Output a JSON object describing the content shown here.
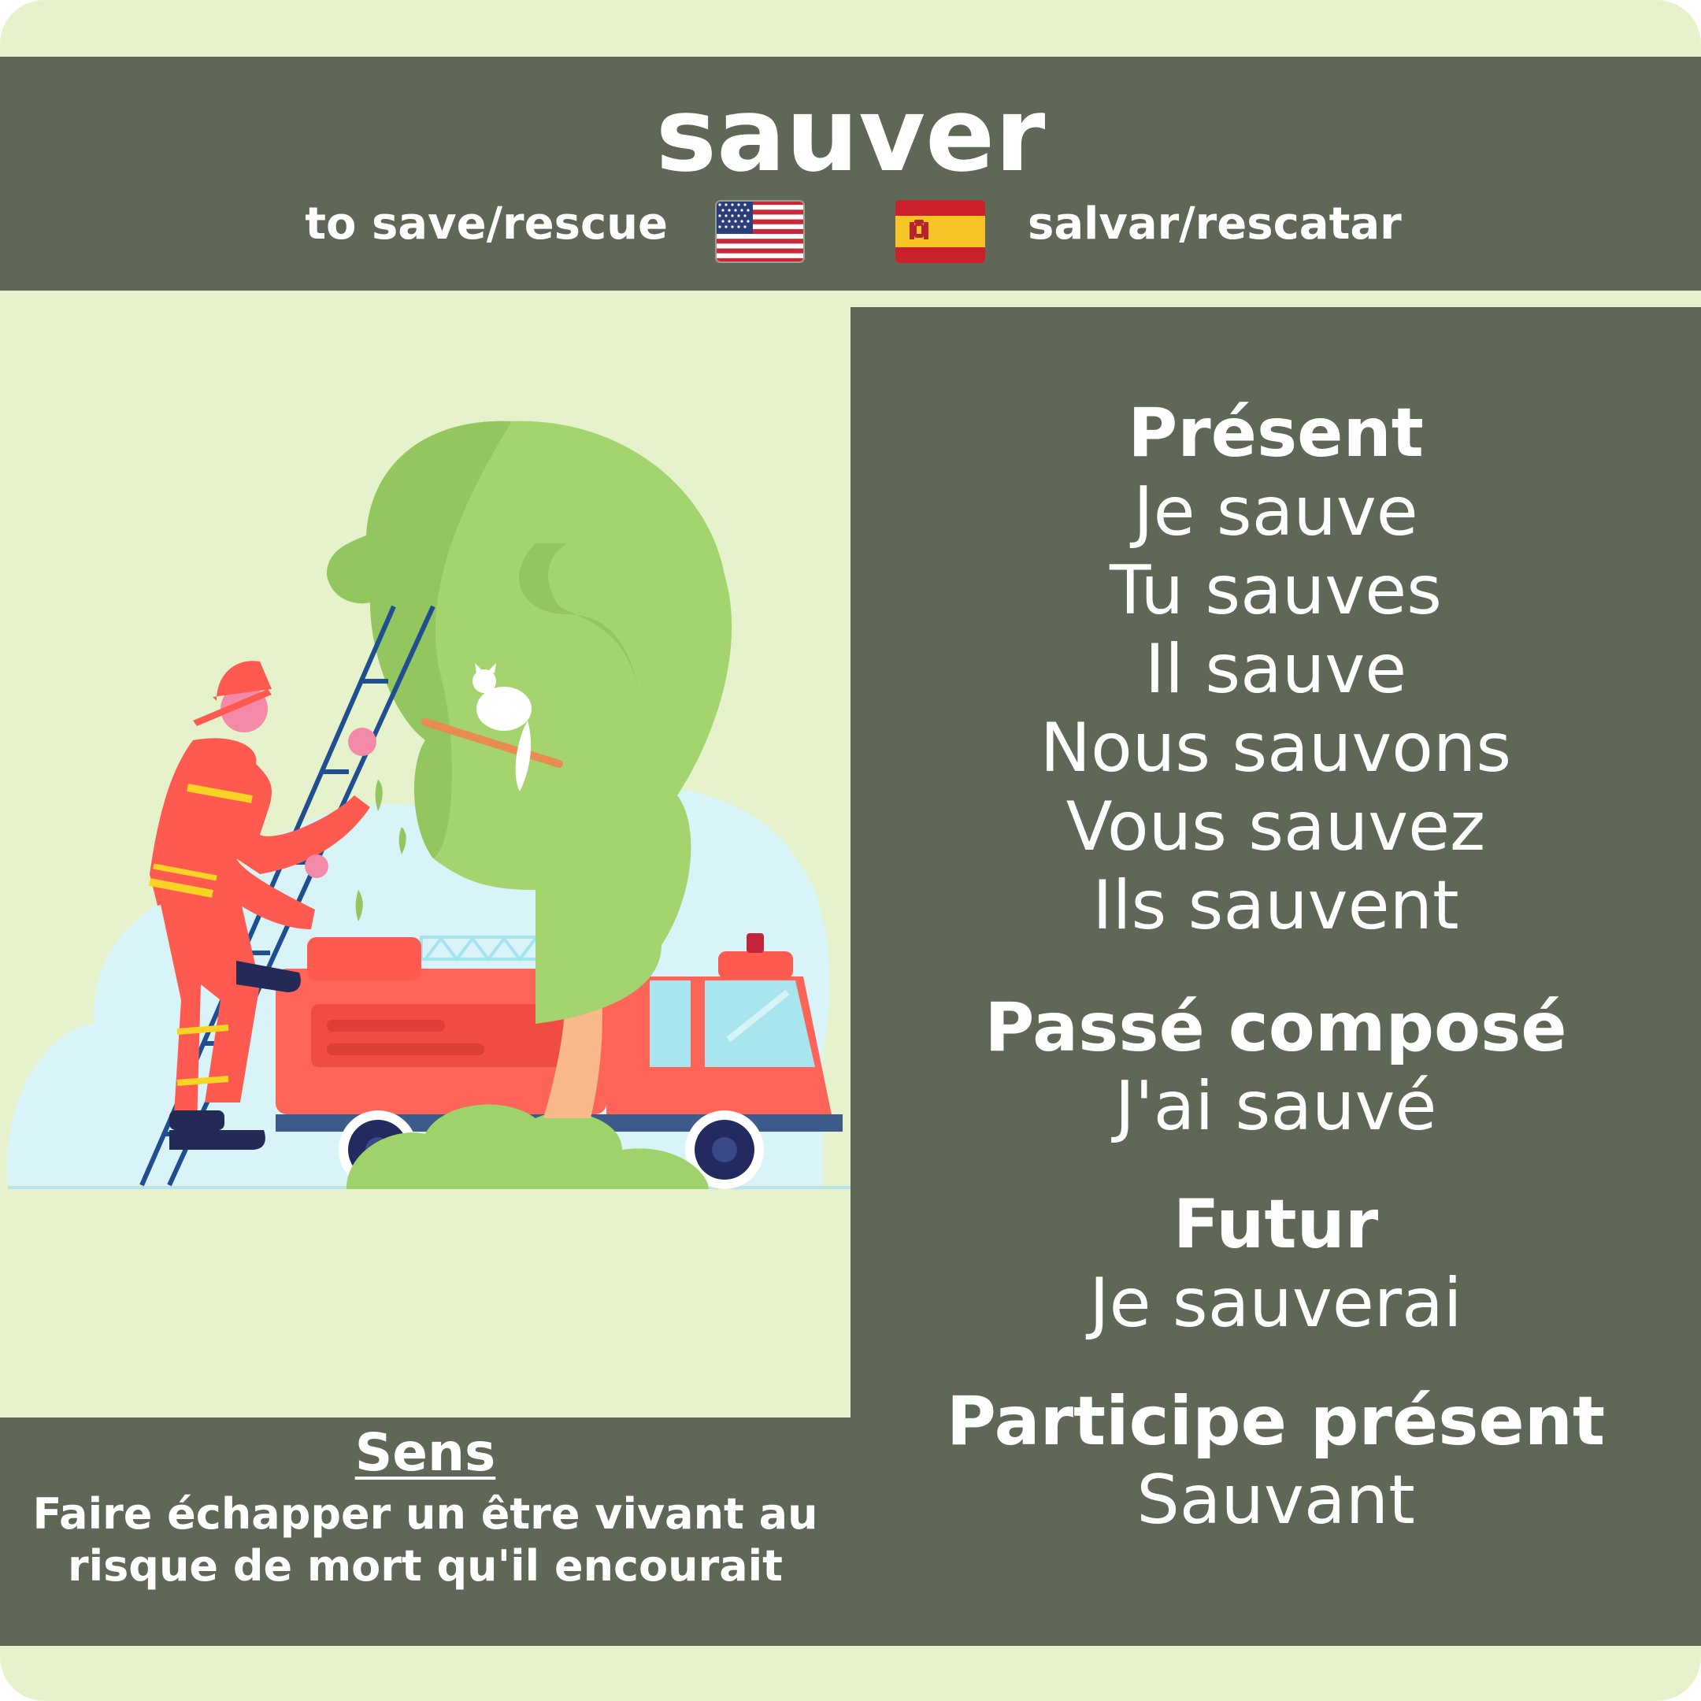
{
  "verb": "sauver",
  "translations": {
    "english": "to save/rescue",
    "spanish": "salvar/rescatar"
  },
  "icons": {
    "us_flag": "us-flag-icon",
    "spain_flag": "spain-flag-icon",
    "illustration": "firefighter-rescuing-cat-illustration"
  },
  "colors": {
    "background": "#e6f2cc",
    "panel": "#5f6756",
    "text": "#ffffff"
  },
  "conjugations": {
    "present": {
      "label": "Présent",
      "forms": [
        "Je sauve",
        "Tu sauves",
        "Il sauve",
        "Nous sauvons",
        "Vous sauvez",
        "Ils sauvent"
      ]
    },
    "passe_compose": {
      "label": "Passé composé",
      "form": "J'ai sauvé"
    },
    "futur": {
      "label": "Futur",
      "form": "Je sauverai"
    },
    "participe_present": {
      "label": "Participe présent",
      "form": "Sauvant"
    }
  },
  "meaning": {
    "label": "Sens",
    "line1": "Faire échapper un être vivant au",
    "line2": "risque de mort qu'il encourait"
  }
}
